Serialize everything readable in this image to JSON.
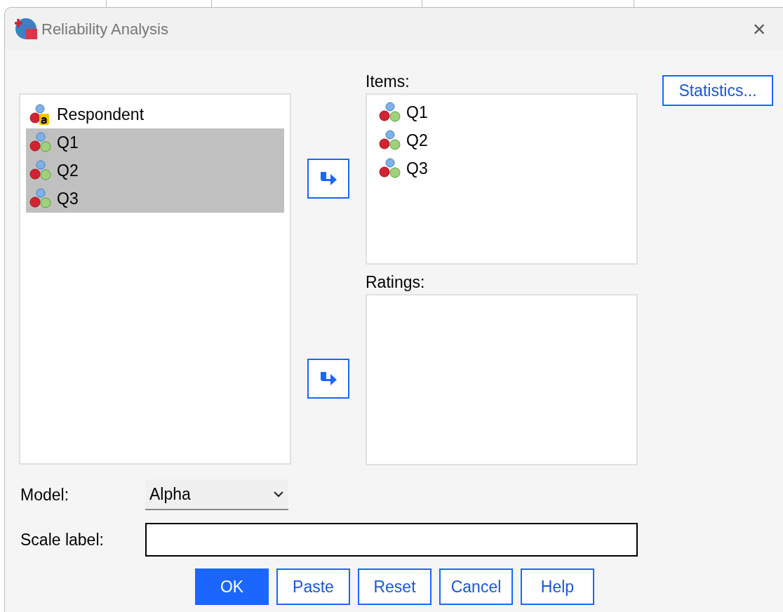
{
  "window": {
    "title": "Reliability Analysis",
    "close": "×"
  },
  "source_list": {
    "items": [
      {
        "name": "Respondent",
        "kind": "string",
        "selected": false
      },
      {
        "name": "Q1",
        "kind": "nominal",
        "selected": true
      },
      {
        "name": "Q2",
        "kind": "nominal",
        "selected": true
      },
      {
        "name": "Q3",
        "kind": "nominal",
        "selected": true
      }
    ]
  },
  "items": {
    "label": "Items:",
    "items": [
      {
        "name": "Q1",
        "kind": "nominal",
        "selected": false
      },
      {
        "name": "Q2",
        "kind": "nominal",
        "selected": false
      },
      {
        "name": "Q3",
        "kind": "nominal",
        "selected": false
      }
    ]
  },
  "ratings": {
    "label": "Ratings:"
  },
  "statistics_button": "Statistics...",
  "model": {
    "label": "Model:",
    "value": "Alpha"
  },
  "scale_label": {
    "label": "Scale label:"
  },
  "buttons": [
    {
      "label": "OK",
      "default": true
    },
    {
      "label": "Paste",
      "default": false
    },
    {
      "label": "Reset",
      "default": false
    },
    {
      "label": "Cancel",
      "default": false
    },
    {
      "label": "Help",
      "default": false
    }
  ]
}
